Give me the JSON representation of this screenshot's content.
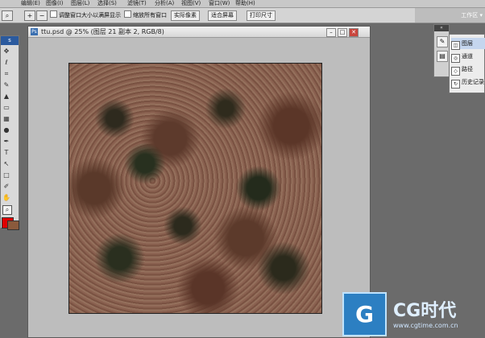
{
  "menu": {
    "items": [
      "编辑(E)",
      "图像(I)",
      "图层(L)",
      "选择(S)",
      "滤镜(T)",
      "分析(A)",
      "视图(V)",
      "窗口(W)",
      "帮助(H)"
    ]
  },
  "options": {
    "check_resize": "调整窗口大小以满屏显示",
    "check_zoom_all": "缩放所有窗口",
    "btn_actual": "实际像素",
    "btn_fit": "适合屏幕",
    "btn_print": "打印尺寸"
  },
  "brand": {
    "workspace": "工作区 ▾"
  },
  "toolbox": {
    "header": "s"
  },
  "document": {
    "title": "ttu.psd @ 25% (图层 21 副本 2, RGB/8)"
  },
  "panels": {
    "layers": "图层",
    "channels": "通道",
    "paths": "路径",
    "history": "历史记录"
  },
  "watermark": {
    "name": "CG时代",
    "url": "www.cgtime.com.cn"
  },
  "colors": {
    "foreground": "#e00000",
    "background": "#8a5a3c",
    "accent": "#2c7fc2"
  }
}
